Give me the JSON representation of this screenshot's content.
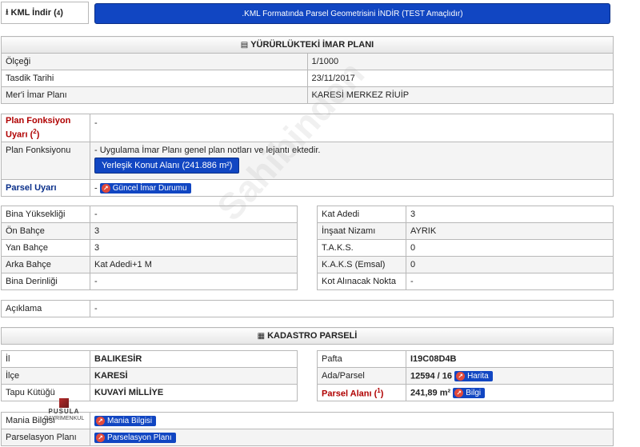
{
  "kml": {
    "label": "KML İndir (",
    "label_sup": "4",
    "label_end": ")",
    "button": ".KML Formatında Parsel Geometrisini İNDİR (TEST Amaçlıdır)"
  },
  "imar": {
    "title": "YÜRÜRLÜKTEKİ İMAR PLANI",
    "rows": [
      {
        "label": "Ölçeği",
        "value": "1/1000"
      },
      {
        "label": "Tasdik Tarihi",
        "value": "23/11/2017"
      },
      {
        "label": "Mer'i İmar Planı",
        "value": "KARESİ MERKEZ RİUİP"
      }
    ]
  },
  "plan": {
    "fonksiyon_uyari_label": "Plan Fonksiyon Uyarı (",
    "fonksiyon_uyari_sup": "2",
    "fonksiyon_uyari_end": ")",
    "fonksiyon_uyari_value": "-",
    "fonksiyon_label": "Plan Fonksiyonu",
    "fonksiyon_note": "- Uygulama İmar Planı genel plan notları ve lejantı ektedir.",
    "fonksiyon_button": "Yerleşik Konut Alanı (241.886 m²)",
    "parsel_uyari_label": "Parsel Uyarı",
    "parsel_uyari_dash": "-",
    "parsel_uyari_chip": "Güncel İmar Durumu"
  },
  "left_rows": [
    {
      "label": "Bina Yüksekliği",
      "value": "-"
    },
    {
      "label": "Ön Bahçe",
      "value": "3"
    },
    {
      "label": "Yan Bahçe",
      "value": "3"
    },
    {
      "label": "Arka Bahçe",
      "value": "Kat Adedi+1 M"
    },
    {
      "label": "Bina Derinliği",
      "value": "-"
    }
  ],
  "right_rows": [
    {
      "label": "Kat Adedi",
      "value": "3"
    },
    {
      "label": "İnşaat Nizamı",
      "value": "AYRIK"
    },
    {
      "label": "T.A.K.S.",
      "value": "0"
    },
    {
      "label": "K.A.K.S (Emsal)",
      "value": "0"
    },
    {
      "label": "Kot Alınacak Nokta",
      "value": "-"
    }
  ],
  "aciklama": {
    "label": "Açıklama",
    "value": "-"
  },
  "kadastro": {
    "title": "KADASTRO PARSELİ",
    "left": [
      {
        "label": "İl",
        "value": "BALIKESİR"
      },
      {
        "label": "İlçe",
        "value": "KARESİ"
      },
      {
        "label": "Tapu Kütüğü",
        "value": "KUVAYİ MİLLİYE"
      }
    ],
    "pafta_label": "Pafta",
    "pafta_value": "I19C08D4B",
    "ada_label": "Ada/Parsel",
    "ada_value": "12594 / 16",
    "ada_chip": "Harita",
    "alan_label": "Parsel Alanı (",
    "alan_sup": "1",
    "alan_end": ")",
    "alan_value": "241,89 m²",
    "alan_chip": "Bilgi"
  },
  "mania": {
    "label": "Mania Bilgisi",
    "chip": "Mania Bilgisi"
  },
  "parselasyon": {
    "label": "Parselasyon Planı",
    "chip": "Parselasyon Planı"
  },
  "logo": {
    "name": "PUSULA",
    "tag": "GAYRİMENKUL"
  },
  "watermark": "Sahibinden"
}
